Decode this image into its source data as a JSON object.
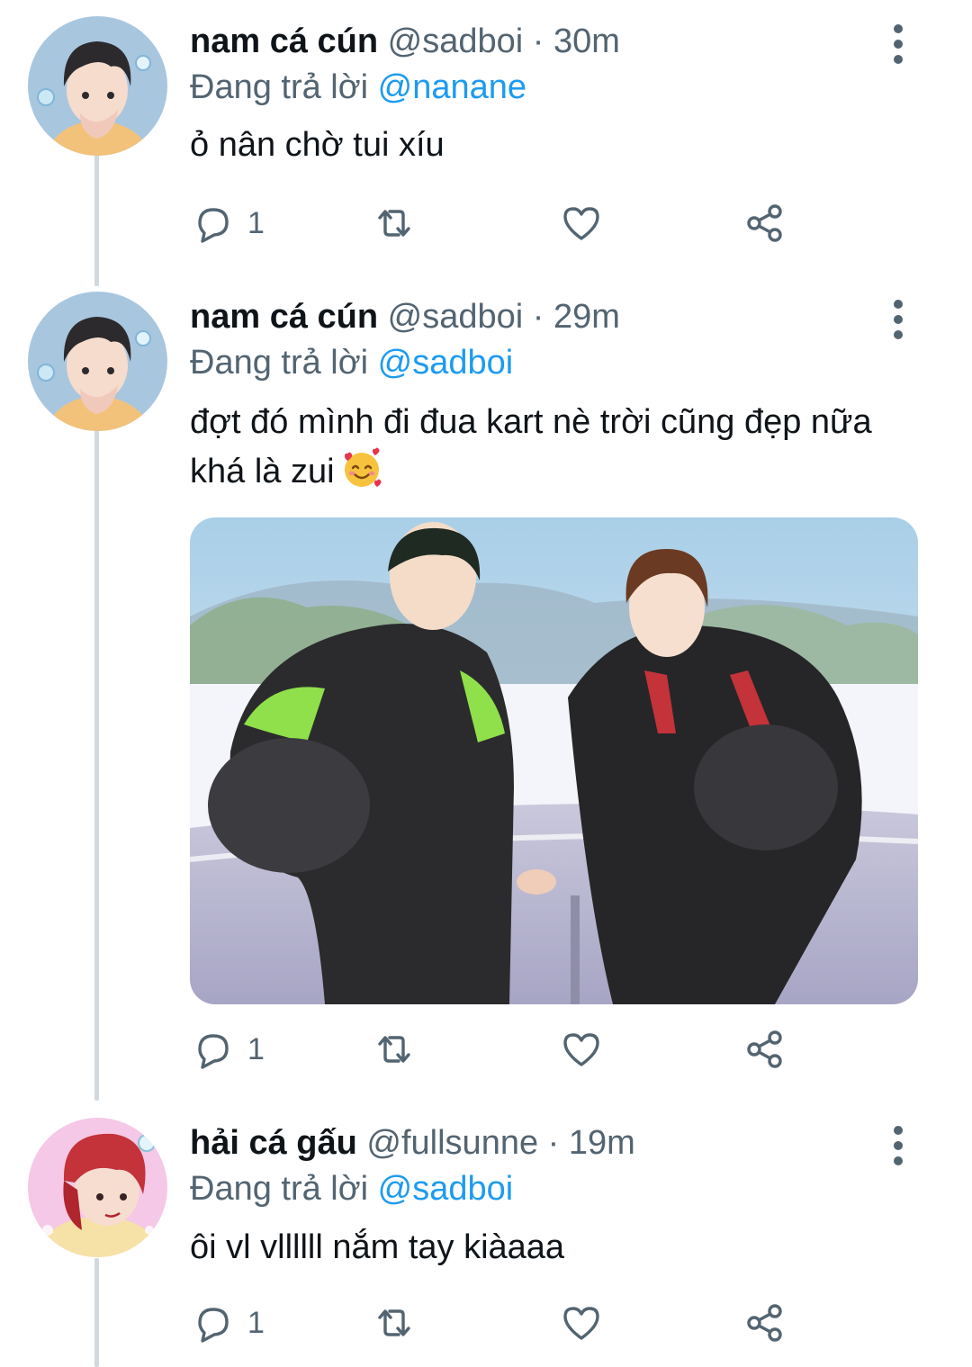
{
  "tweets": [
    {
      "display_name": "nam cá cún",
      "handle": "@sadboi",
      "separator": "·",
      "time": "30m",
      "reply_prefix": "Đang trả lời",
      "reply_to": "@nanane",
      "text": "ỏ nân chờ tui xíu",
      "reply_count": "1"
    },
    {
      "display_name": "nam cá cún",
      "handle": "@sadboi",
      "separator": "·",
      "time": "29m",
      "reply_prefix": "Đang trả lời",
      "reply_to": "@sadboi",
      "text": "đợt đó mình đi đua kart nè trời cũng đẹp nữa khá là zui",
      "emoji": "smiling-face-with-hearts",
      "reply_count": "1"
    },
    {
      "display_name": "hải cá gấu",
      "handle": "@fullsunne",
      "separator": "·",
      "time": "19m",
      "reply_prefix": "Đang trả lời",
      "reply_to": "@sadboi",
      "text": "ôi vl vllllll nắm tay kiàaaa",
      "reply_count": "1"
    }
  ],
  "icons": {
    "reply": "reply-icon",
    "retweet": "retweet-icon",
    "like": "heart-icon",
    "share": "share-icon",
    "more": "more-vertical-icon"
  },
  "colors": {
    "text": "#0f1419",
    "secondary": "#536471",
    "mention": "#1d9bf0",
    "thread_line": "#cfd9de"
  }
}
